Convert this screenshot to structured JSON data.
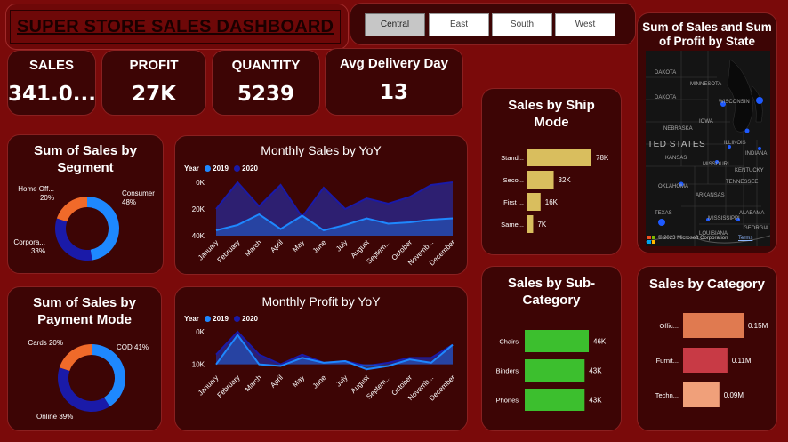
{
  "header": {
    "title": "SUPER STORE SALES DASHBOARD"
  },
  "slicer": {
    "options": [
      "Central",
      "East",
      "South",
      "West"
    ],
    "selected": "Central"
  },
  "kpis": [
    {
      "label": "SALES",
      "value": "341.0..."
    },
    {
      "label": "PROFIT",
      "value": "27K"
    },
    {
      "label": "QUANTITY",
      "value": "5239"
    },
    {
      "label": "Avg Delivery Day",
      "value": "13"
    }
  ],
  "segment": {
    "title": "Sum of Sales by Segment",
    "slices": [
      {
        "label": "Consumer",
        "pct": "48%",
        "value": 48,
        "color": "#1e88ff"
      },
      {
        "label": "Corpora...",
        "pct": "33%",
        "value": 33,
        "color": "#1a1aa8"
      },
      {
        "label": "Home Off...",
        "pct": "20%",
        "value": 20,
        "color": "#f06a2a"
      }
    ]
  },
  "payment": {
    "title": "Sum of Sales by Payment Mode",
    "slices": [
      {
        "label": "COD",
        "pct": "41%",
        "value": 41,
        "color": "#1e88ff"
      },
      {
        "label": "Online",
        "pct": "39%",
        "value": 39,
        "color": "#1a1aa8"
      },
      {
        "label": "Cards",
        "pct": "20%",
        "value": 20,
        "color": "#f06a2a"
      }
    ]
  },
  "monthly_sales": {
    "title": "Monthly Sales by YoY",
    "legend_title": "Year",
    "series_names": [
      "2019",
      "2020"
    ],
    "yticks": [
      "40K",
      "20K",
      "0K"
    ]
  },
  "monthly_profit": {
    "title": "Monthly Profit by YoY",
    "legend_title": "Year",
    "series_names": [
      "2019",
      "2020"
    ],
    "yticks": [
      "10K",
      "0K"
    ]
  },
  "months": [
    "January",
    "February",
    "March",
    "April",
    "May",
    "June",
    "July",
    "August",
    "Septem...",
    "October",
    "Novemb...",
    "December"
  ],
  "ship_mode": {
    "title": "Sales by Ship Mode",
    "bars": [
      {
        "label": "Stand...",
        "value_label": "78K",
        "value": 78
      },
      {
        "label": "Seco...",
        "value_label": "32K",
        "value": 32
      },
      {
        "label": "First ...",
        "value_label": "16K",
        "value": 16
      },
      {
        "label": "Same...",
        "value_label": "7K",
        "value": 7
      }
    ]
  },
  "sub_category": {
    "title": "Sales by Sub-Category",
    "bars": [
      {
        "label": "Chairs",
        "value_label": "46K",
        "value": 46
      },
      {
        "label": "Binders",
        "value_label": "43K",
        "value": 43
      },
      {
        "label": "Phones",
        "value_label": "43K",
        "value": 43
      }
    ]
  },
  "category": {
    "title": "Sales by Category",
    "bars": [
      {
        "label": "Offic...",
        "value_label": "0.15M",
        "value": 0.15,
        "color": "#e07a50"
      },
      {
        "label": "Furnit...",
        "value_label": "0.11M",
        "value": 0.11,
        "color": "#c83a45"
      },
      {
        "label": "Techn...",
        "value_label": "0.09M",
        "value": 0.09,
        "color": "#f0a07a"
      }
    ]
  },
  "map": {
    "title": "Sum of Sales and Sum of Profit by State",
    "place_labels": [
      "TED STATES",
      "DAKOTA",
      "DAKOTA",
      "MINNESOTA",
      "WISCONSIN",
      "IOWA",
      "NEBRASKA",
      "KANSAS",
      "MISSOURI",
      "ILLINOIS",
      "INDIANA",
      "OKLAHOMA",
      "ARKANSAS",
      "TENNESSEE",
      "TEXAS",
      "MISSISSIPPI",
      "ALABAMA",
      "LOUISIANA",
      "GEORGIA",
      "KENTUCKY"
    ],
    "copyright": "© 2023 Microsoft Corporation",
    "terms": "Terms"
  },
  "chart_data": [
    {
      "type": "area",
      "title": "Monthly Sales by YoY",
      "legend_title": "Year",
      "categories": [
        "January",
        "February",
        "March",
        "April",
        "May",
        "June",
        "July",
        "August",
        "Septem...",
        "October",
        "Novemb...",
        "December"
      ],
      "series": [
        {
          "name": "2019",
          "values": [
            4,
            8,
            16,
            5,
            15,
            4,
            8,
            13,
            9,
            10,
            12,
            13
          ]
        },
        {
          "name": "2020",
          "values": [
            20,
            40,
            22,
            38,
            14,
            36,
            20,
            28,
            24,
            29,
            38,
            40
          ]
        }
      ],
      "ylim": [
        0,
        40
      ],
      "yticks": [
        "0K",
        "20K",
        "40K"
      ],
      "legend_placement": "top-left"
    },
    {
      "type": "area",
      "title": "Monthly Profit by YoY",
      "legend_title": "Year",
      "categories": [
        "January",
        "February",
        "March",
        "April",
        "May",
        "June",
        "July",
        "August",
        "Septem...",
        "October",
        "Novemb...",
        "December"
      ],
      "series": [
        {
          "name": "2019",
          "values": [
            0,
            9,
            0,
            -0.5,
            2,
            0.5,
            1,
            -1.5,
            -0.5,
            1.5,
            0.5,
            6
          ]
        },
        {
          "name": "2020",
          "values": [
            3,
            10,
            3,
            0,
            3,
            0.5,
            1,
            -0.5,
            0.5,
            2,
            2,
            6
          ]
        }
      ],
      "ylim": [
        -2,
        10
      ],
      "yticks": [
        "0K",
        "10K"
      ],
      "legend_placement": "top-left"
    },
    {
      "type": "bar",
      "title": "Sales by Ship Mode",
      "categories": [
        "Stand...",
        "Seco...",
        "First ...",
        "Same..."
      ],
      "values": [
        78,
        32,
        16,
        7
      ]
    },
    {
      "type": "bar",
      "title": "Sales by Sub-Category",
      "categories": [
        "Chairs",
        "Binders",
        "Phones"
      ],
      "values": [
        46,
        43,
        43
      ]
    },
    {
      "type": "bar",
      "title": "Sales by Category",
      "categories": [
        "Offic...",
        "Furnit...",
        "Techn..."
      ],
      "values": [
        0.15,
        0.11,
        0.09
      ]
    },
    {
      "type": "pie",
      "title": "Sum of Sales by Segment",
      "categories": [
        "Consumer",
        "Corpora...",
        "Home Off..."
      ],
      "values": [
        48,
        33,
        20
      ]
    },
    {
      "type": "pie",
      "title": "Sum of Sales by Payment Mode",
      "categories": [
        "COD",
        "Online",
        "Cards"
      ],
      "values": [
        41,
        39,
        20
      ]
    }
  ]
}
